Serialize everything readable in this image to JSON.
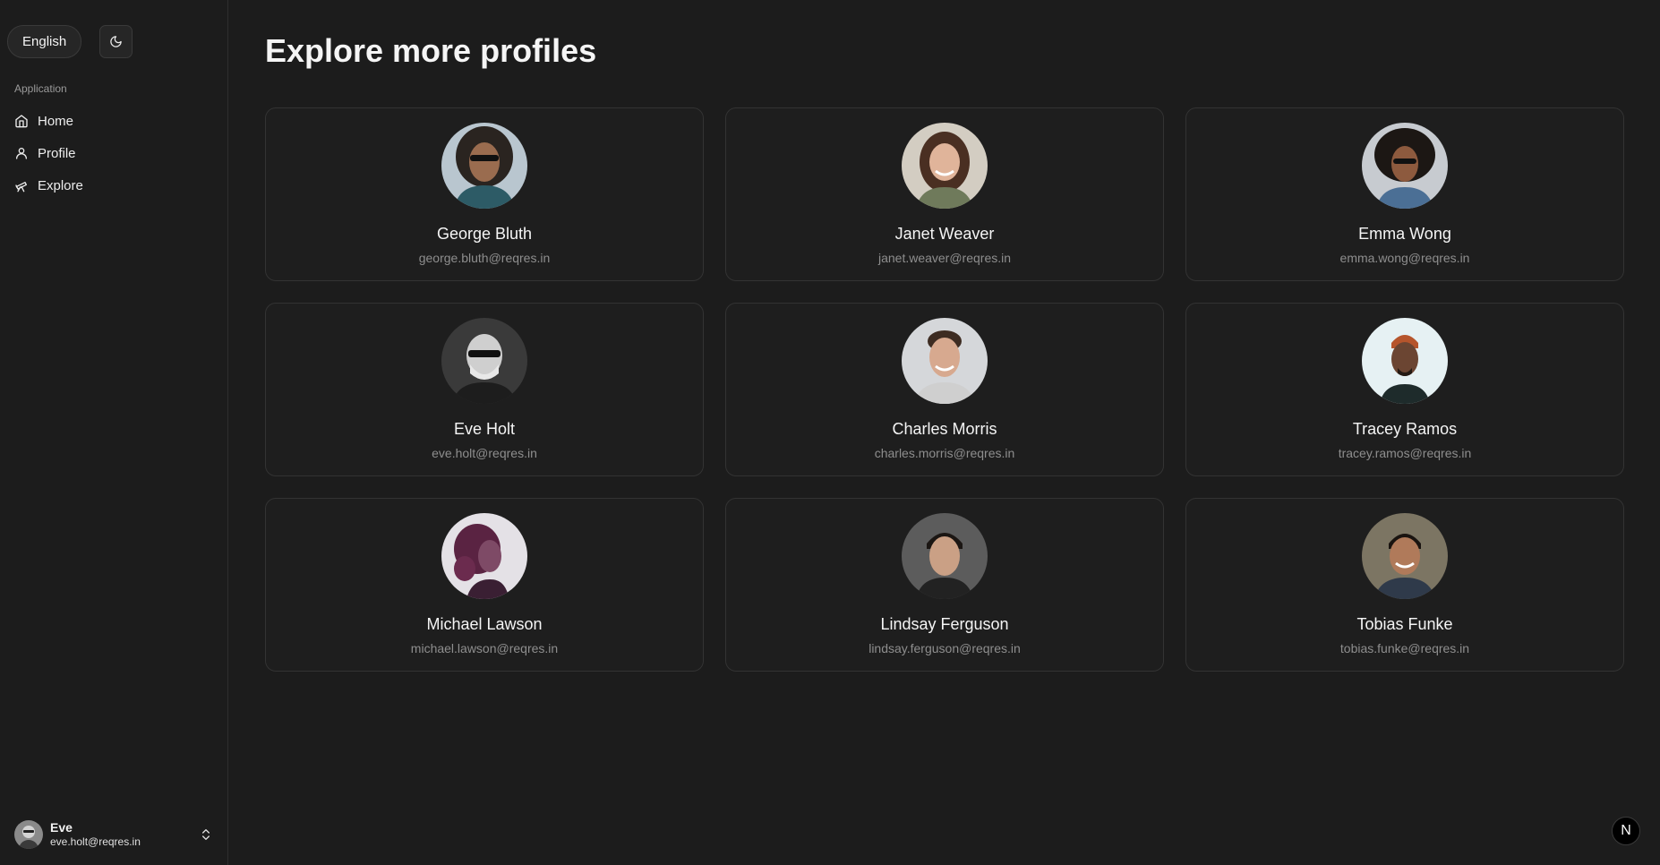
{
  "sidebar": {
    "language_label": "English",
    "theme_icon": "moon-icon",
    "group_label": "Application",
    "items": [
      {
        "label": "Home",
        "icon": "home-icon"
      },
      {
        "label": "Profile",
        "icon": "user-icon"
      },
      {
        "label": "Explore",
        "icon": "telescope-icon"
      }
    ],
    "user": {
      "name": "Eve",
      "email": "eve.holt@reqres.in"
    }
  },
  "main": {
    "title": "Explore more profiles",
    "profiles": [
      {
        "name": "George Bluth",
        "email": "george.bluth@reqres.in"
      },
      {
        "name": "Janet Weaver",
        "email": "janet.weaver@reqres.in"
      },
      {
        "name": "Emma Wong",
        "email": "emma.wong@reqres.in"
      },
      {
        "name": "Eve Holt",
        "email": "eve.holt@reqres.in"
      },
      {
        "name": "Charles Morris",
        "email": "charles.morris@reqres.in"
      },
      {
        "name": "Tracey Ramos",
        "email": "tracey.ramos@reqres.in"
      },
      {
        "name": "Michael Lawson",
        "email": "michael.lawson@reqres.in"
      },
      {
        "name": "Lindsay Ferguson",
        "email": "lindsay.ferguson@reqres.in"
      },
      {
        "name": "Tobias Funke",
        "email": "tobias.funke@reqres.in"
      }
    ]
  },
  "badge": {
    "label": "N"
  }
}
